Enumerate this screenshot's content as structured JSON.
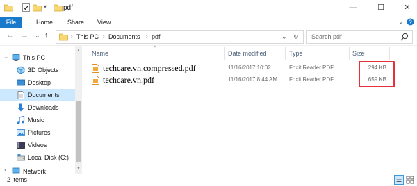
{
  "window": {
    "title": "pdf",
    "minimize": "—",
    "maximize": "☐",
    "close": "✕"
  },
  "ribbon": {
    "tabs": [
      "File",
      "Home",
      "Share",
      "View"
    ],
    "collapse_icon": "chevron-down-icon",
    "help_icon": "help-icon"
  },
  "navigation": {
    "back": "←",
    "forward": "→",
    "recent": "⌄",
    "up": "↑"
  },
  "address": {
    "crumbs": [
      "This PC",
      "Documents",
      "pdf"
    ],
    "dropdown": "⌄",
    "refresh": "↻"
  },
  "search": {
    "placeholder": "Search pdf"
  },
  "sidebar": {
    "items": [
      {
        "label": "This PC",
        "icon": "computer-icon"
      },
      {
        "label": "3D Objects",
        "icon": "3d-objects-icon"
      },
      {
        "label": "Desktop",
        "icon": "desktop-icon"
      },
      {
        "label": "Documents",
        "icon": "documents-icon",
        "selected": true
      },
      {
        "label": "Downloads",
        "icon": "downloads-icon"
      },
      {
        "label": "Music",
        "icon": "music-icon"
      },
      {
        "label": "Pictures",
        "icon": "pictures-icon"
      },
      {
        "label": "Videos",
        "icon": "videos-icon"
      },
      {
        "label": "Local Disk (C:)",
        "icon": "drive-icon"
      },
      {
        "label": "Network",
        "icon": "network-icon"
      }
    ]
  },
  "table": {
    "columns": [
      "Name",
      "Date modified",
      "Type",
      "Size"
    ],
    "rows": [
      {
        "name": "techcare.vn.compressed.pdf",
        "date": "11/16/2017 10:02 ...",
        "type": "Foxit Reader PDF ...",
        "size": "294 KB"
      },
      {
        "name": "techcare.vn.pdf",
        "date": "11/16/2017 8:44 AM",
        "type": "Foxit Reader PDF ...",
        "size": "659 KB"
      }
    ]
  },
  "status": {
    "item_count": "2 items"
  },
  "colors": {
    "accent": "#1979ca",
    "selection": "#cce8ff",
    "highlight": "#e8303a",
    "folder": "#f8d775"
  }
}
